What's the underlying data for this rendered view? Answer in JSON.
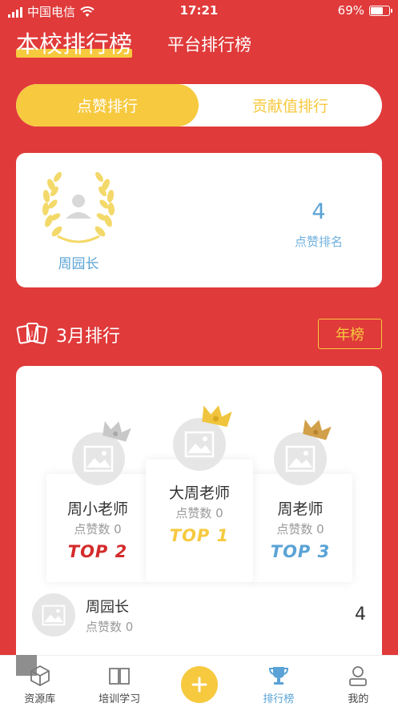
{
  "status_bar": {
    "carrier": "中国电信",
    "time": "17:21",
    "battery": "69%",
    "battery_level": 0.69
  },
  "top_tabs": {
    "active": "本校排行榜",
    "inactive": "平台排行榜"
  },
  "segment": {
    "active": "点赞排行",
    "inactive": "贡献值排行"
  },
  "my_rank": {
    "name": "周园长",
    "rank": "4",
    "rank_label": "点赞排名"
  },
  "month_section": {
    "title": "3月排行",
    "year_button": "年榜"
  },
  "podium": [
    {
      "place": "second",
      "name": "周小老师",
      "likes": "点赞数 0",
      "top_label": "TOP 2",
      "color": "#d42b2b",
      "crown_color": "#c8c8c8"
    },
    {
      "place": "first",
      "name": "大周老师",
      "likes": "点赞数 0",
      "top_label": "TOP 1",
      "color": "#f6c93f",
      "crown_color": "#f0c53d"
    },
    {
      "place": "third",
      "name": "周老师",
      "likes": "点赞数 0",
      "top_label": "TOP 3",
      "color": "#5aa3d6",
      "crown_color": "#d2a04a"
    }
  ],
  "list": [
    {
      "name": "周园长",
      "likes": "点赞数 0",
      "rank": "4"
    }
  ],
  "tabbar": [
    {
      "label": "资源库",
      "icon": "cube-icon"
    },
    {
      "label": "培训学习",
      "icon": "book-icon"
    },
    {
      "label": "",
      "icon": "plus-icon"
    },
    {
      "label": "排行榜",
      "icon": "trophy-icon"
    },
    {
      "label": "我的",
      "icon": "user-icon"
    }
  ],
  "colors": {
    "background": "#e03a3a",
    "accent_yellow": "#f6c93f",
    "accent_blue": "#5aa3d6"
  }
}
